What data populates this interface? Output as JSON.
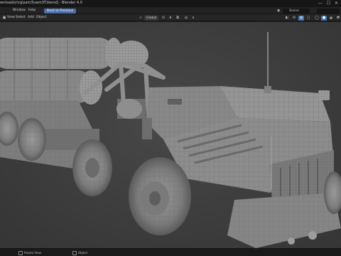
{
  "window": {
    "title": "wnloads\\r\\rg\\sam3\\sam3T.blend] - Blender 4.0",
    "controls": [
      "—",
      "☐",
      "✕"
    ]
  },
  "menubar": {
    "items": [
      "Window",
      "Help"
    ],
    "back_button": "Back to Previous",
    "scene_label": "Scene"
  },
  "header": {
    "items": [
      "View",
      "Select",
      "Add",
      "Object"
    ],
    "transform_orientation": "Global"
  },
  "status": {
    "left_label": "Rotate View",
    "right_label": "Object"
  },
  "colors": {
    "model_fill": "#8b8b8b",
    "model_shade": "#6e6e6e",
    "model_light": "#a4a4a4",
    "wire": "#5a5a5a",
    "background": "#3d3d3d",
    "accent": "#4772b3"
  },
  "icons": {
    "blender": "blender-logo-icon",
    "scene": "scene-icon",
    "gizmo": "gizmo-icon",
    "overlay": "overlay-icon"
  }
}
